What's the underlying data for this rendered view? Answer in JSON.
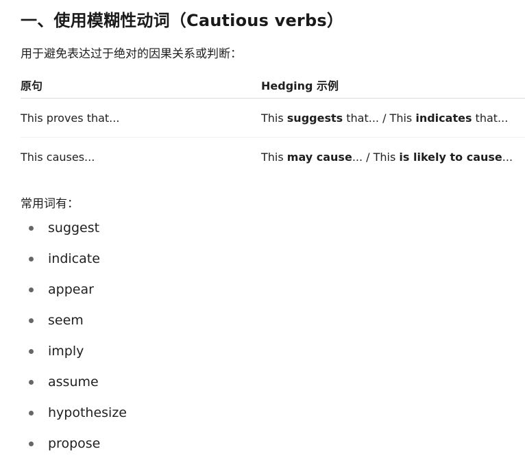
{
  "heading": "一、使用模糊性动词（Cautious verbs）",
  "intro": "用于避免表达过于绝对的因果关系或判断：",
  "table": {
    "headers": [
      "原句",
      "Hedging 示例"
    ],
    "rows": [
      {
        "original": "This proves that...",
        "hedged": {
          "p1": "This ",
          "b1": "suggests",
          "p2": " that... / This ",
          "b2": "indicates",
          "p3": " that..."
        }
      },
      {
        "original": "This causes...",
        "hedged": {
          "p1": "This ",
          "b1": "may cause",
          "p2": "... / This ",
          "b2": "is likely to cause",
          "p3": "..."
        }
      }
    ]
  },
  "common_label": "常用词有：",
  "common_words": [
    "suggest",
    "indicate",
    "appear",
    "seem",
    "imply",
    "assume",
    "hypothesize",
    "propose"
  ],
  "colors": {
    "text": "#1f1f1f",
    "bullet": "#666666",
    "rule": "#dcdcdc"
  }
}
